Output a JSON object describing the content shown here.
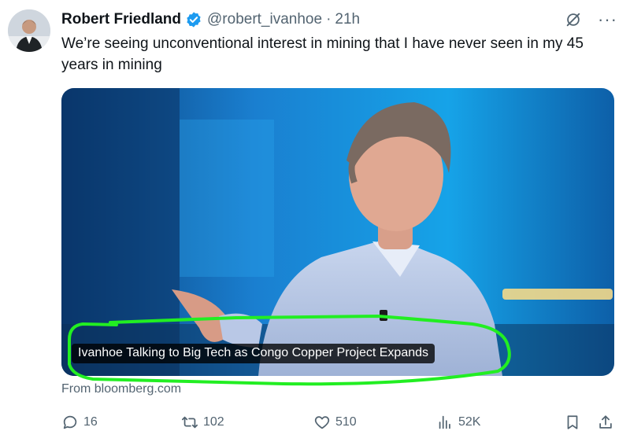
{
  "author": {
    "name": "Robert Friedland",
    "handle": "@robert_ivanhoe",
    "separator": "·",
    "time": "21h"
  },
  "icons": {
    "verified": "verified-badge-icon",
    "grok": "grok-icon",
    "more": "more-icon",
    "reply": "reply-icon",
    "retweet": "retweet-icon",
    "like": "like-icon",
    "views": "views-icon",
    "bookmark": "bookmark-icon",
    "share": "share-icon"
  },
  "more_glyph": "···",
  "tweet": {
    "text": "We’re seeing unconventional interest in mining that I have never seen in my 45 years in mining"
  },
  "card": {
    "title": "Ivanhoe Talking to Big Tech as Congo Copper Project Expands",
    "source": "From bloomberg.com"
  },
  "stats": {
    "replies": "16",
    "retweets": "102",
    "likes": "510",
    "views": "52K"
  },
  "colors": {
    "verified": "#1d9bf0",
    "text": "#0f1419",
    "muted": "#536471",
    "highlight": "#22ee22"
  }
}
